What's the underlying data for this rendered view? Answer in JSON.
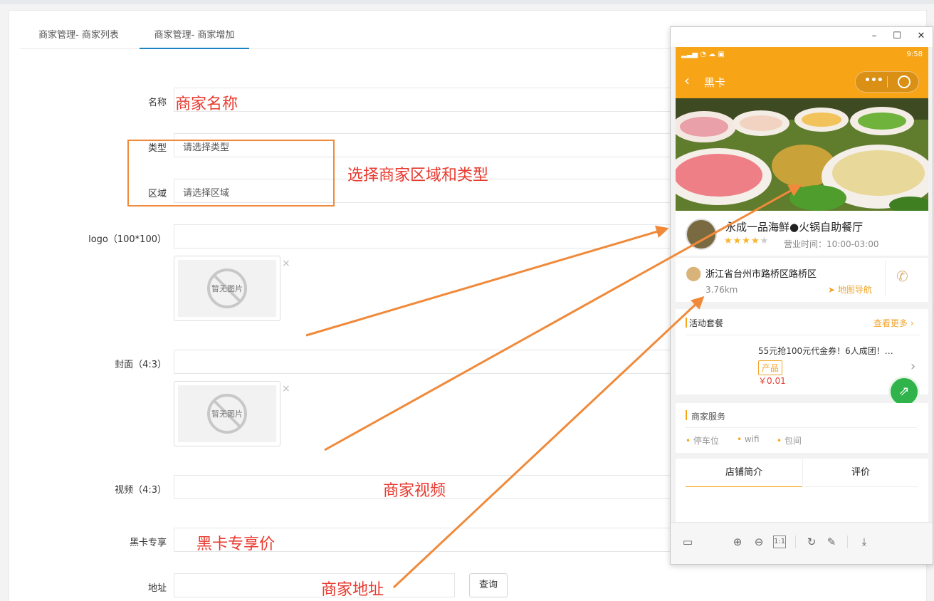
{
  "tabs": [
    {
      "label": "商家管理- 商家列表"
    },
    {
      "label": "商家管理- 商家增加"
    }
  ],
  "form": {
    "name_label": "名称",
    "type_label": "类型",
    "type_placeholder": "请选择类型",
    "area_label": "区域",
    "area_placeholder": "请选择区域",
    "logo_label": "logo（100*100）",
    "cover_label": "封面（4:3）",
    "video_label": "视频（4:3）",
    "blackcard_label": "黑卡专享",
    "address_label": "地址",
    "query_button": "查询",
    "no_image_text": "暂无图片",
    "remove_glyph": "×"
  },
  "annotations": {
    "name": "商家名称",
    "area_type": "选择商家区域和类型",
    "video": "商家视频",
    "blackcard": "黑卡专享价",
    "address": "商家地址"
  },
  "phone": {
    "status_time": "9:58",
    "nav_title": "黑卡",
    "shop_name": "永成一品海鲜●火锅自助餐厅",
    "rating_stars": 4,
    "rating_max": 5,
    "hours": "营业时间：10:00-03:00",
    "address": "浙江省台州市路桥区路桥区",
    "distance": "3.76km",
    "map_nav": "地图导航",
    "activity_title": "活动套餐",
    "view_more": "查看更多",
    "promo_title": "55元抢100元代金券！6人成团！…",
    "promo_tag": "产品",
    "promo_price": "￥0.01",
    "service_title": "商家服务",
    "services": [
      "停车位",
      "wifi",
      "包间"
    ],
    "tab_intro": "店铺简介",
    "tab_review": "评价"
  },
  "colors": {
    "accent_orange": "#f7a417",
    "annotation_red": "#e83a2f",
    "arrow_orange": "#f08a3a",
    "tab_active": "#1ab394"
  }
}
